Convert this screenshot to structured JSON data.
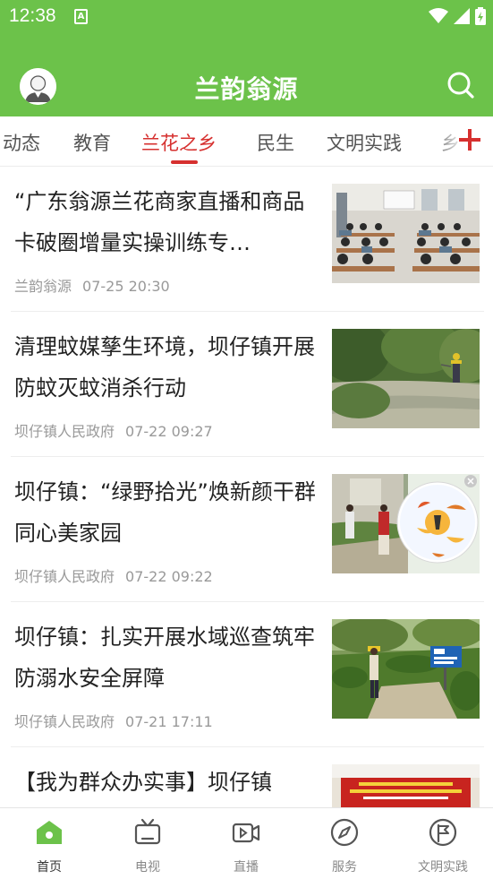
{
  "status_bar": {
    "time": "12:38",
    "notification_icon": "app-notification-icon"
  },
  "app_bar": {
    "title": "兰韵翁源",
    "search_icon": "search-icon",
    "avatar_icon": "user-avatar-icon"
  },
  "tabs": [
    {
      "label": "动态"
    },
    {
      "label": "教育"
    },
    {
      "label": "兰花之乡",
      "active": true
    },
    {
      "label": "民生"
    },
    {
      "label": "文明实践"
    },
    {
      "label": "乡"
    }
  ],
  "tab_add_icon": "plus-icon",
  "news": [
    {
      "title": "“广东翁源兰花商家直播和商品卡破圈增量实操训练专…",
      "source": "兰韵翁源",
      "time": "07-25 20:30"
    },
    {
      "title": "清理蚊媒孳生环境，坝仔镇开展防蚊灭蚊消杀行动",
      "source": "坝仔镇人民政府",
      "time": "07-22 09:27"
    },
    {
      "title": "坝仔镇：“绿野拾光”焕新颜干群同心美家园",
      "source": "坝仔镇人民政府",
      "time": "07-22 09:22"
    },
    {
      "title": "坝仔镇：扎实开展水域巡查筑牢防溺水安全屏障",
      "source": "坝仔镇人民政府",
      "time": "07-21 17:11"
    },
    {
      "title": "【我为群众办实事】坝仔镇",
      "source": "",
      "time": ""
    }
  ],
  "bottom_nav": [
    {
      "label": "首页",
      "icon": "home-icon",
      "active": true
    },
    {
      "label": "电视",
      "icon": "tv-icon"
    },
    {
      "label": "直播",
      "icon": "live-video-icon"
    },
    {
      "label": "服务",
      "icon": "compass-icon"
    },
    {
      "label": "文明实践",
      "icon": "flag-circle-icon"
    }
  ],
  "colors": {
    "brand_green": "#6cc24a",
    "active_red": "#d6302f",
    "meta_gray": "#999999"
  }
}
